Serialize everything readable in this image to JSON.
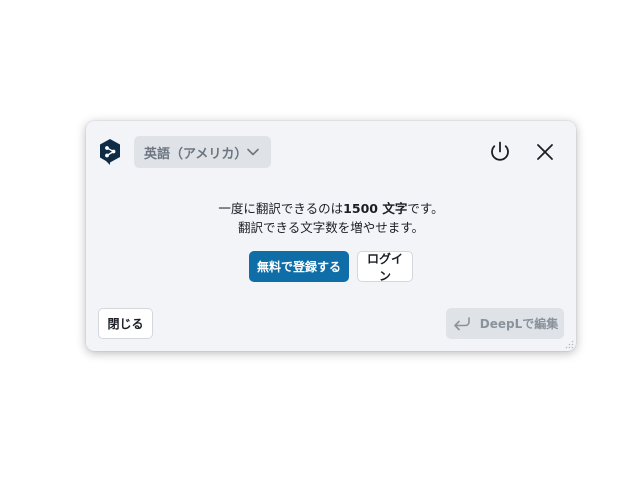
{
  "header": {
    "language_select": {
      "value": "英語（アメリカ）"
    }
  },
  "message": {
    "line1_before": "一度に翻訳できるのは",
    "line1_bold": "1500 文字",
    "line1_after": "です。",
    "line2": "翻訳できる文字数を増やせます。"
  },
  "actions": {
    "signup_label": "無料で登録する",
    "login_label": "ログイン"
  },
  "footer": {
    "close_label": "閉じる",
    "edit_label": "DeepLで編集"
  },
  "icons": {
    "logo": "deepl-logo-icon",
    "chevron": "chevron-down-icon",
    "power": "power-icon",
    "close": "close-icon",
    "return": "return-arrow-icon",
    "grip": "resize-grip-icon"
  },
  "colors": {
    "primary": "#0f6ea8",
    "popup_bg": "#f2f4f8",
    "logo": "#0f2b46"
  }
}
